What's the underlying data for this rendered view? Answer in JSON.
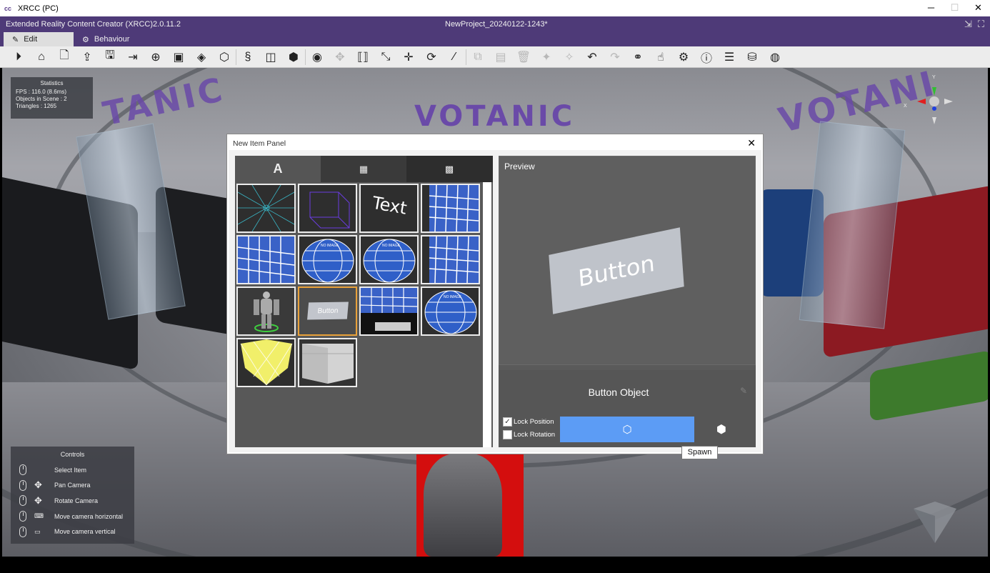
{
  "window": {
    "title": "XRCC (PC)",
    "minimize": "─",
    "maximize": "☐",
    "close": "✕"
  },
  "header": {
    "app_name": "Extended Reality Content Creator (XRCC)2.0.11.2",
    "project_name": "NewProject_20240122-1243*"
  },
  "tabs": [
    {
      "label": "Edit",
      "icon": "edit-icon",
      "active": true
    },
    {
      "label": "Behaviour",
      "icon": "gear-icon",
      "active": false
    }
  ],
  "toolbar": {
    "icons": [
      "play-icon",
      "home-icon",
      "new-file-icon",
      "import-icon",
      "save-icon",
      "save-as-icon",
      "export-icon",
      "cube-package-icon",
      "cube-import-icon",
      "cube-export-icon",
      "script-icon",
      "asset-icon",
      "cube-open-icon",
      "cube-add-icon",
      "eye-icon",
      "move-icon",
      "frame-icon",
      "scale-icon",
      "transform-icon",
      "rotate-cube-icon",
      "wand-icon",
      "copy-icon",
      "paste-icon",
      "trash-icon",
      "pin-icon",
      "multi-pin-icon",
      "undo-icon",
      "redo-icon",
      "link-icon",
      "touch-icon",
      "settings-icon",
      "info-icon",
      "stack-icon",
      "network-icon",
      "unity-icon"
    ]
  },
  "scene": {
    "brand_center": "VOTANIC",
    "brand_left": "TANIC",
    "brand_right": "VOTANI"
  },
  "statistics": {
    "title": "Statistics",
    "fps": "FPS : 116.0 (8.6ms)",
    "objects": "Objects in Scene : 2",
    "triangles": "Triangles : 1265"
  },
  "controls": {
    "title": "Controls",
    "rows": [
      {
        "label": "Select Item"
      },
      {
        "label": "Pan Camera"
      },
      {
        "label": "Rotate Camera"
      },
      {
        "label": "Move camera horizontal"
      },
      {
        "label": "Move camera vertical"
      }
    ]
  },
  "gizmo": {
    "x": "X",
    "y": "Y"
  },
  "modal": {
    "title": "New Item Panel",
    "close": "✕",
    "category_tabs": [
      "text-category-icon",
      "media-category-icon",
      "default-category-icon"
    ],
    "thumbnails": [
      {
        "name": "grid-floor"
      },
      {
        "name": "wire-cube"
      },
      {
        "name": "text",
        "label": "Text"
      },
      {
        "name": "grid-panel"
      },
      {
        "name": "grid-panel-2"
      },
      {
        "name": "sphere-no-image",
        "label": "NO IMAGE"
      },
      {
        "name": "sphere-no-image-2",
        "label": "NO IMAGE"
      },
      {
        "name": "grid-panel-3"
      },
      {
        "name": "avatar"
      },
      {
        "name": "button",
        "label": "Button",
        "selected": true
      },
      {
        "name": "grid-stand"
      },
      {
        "name": "sphere-no-image-3",
        "label": "NO IMAGE"
      },
      {
        "name": "yellow-cube"
      },
      {
        "name": "panel-board"
      }
    ],
    "preview_label": "Preview",
    "preview_text": "Button",
    "object_name": "Button Object",
    "lock_position": {
      "label": "Lock Position",
      "checked": true
    },
    "lock_rotation": {
      "label": "Lock Rotation",
      "checked": false
    },
    "spawn_tooltip": "Spawn"
  },
  "colors": {
    "header_purple": "#4e3a78",
    "selected_border": "#e9a23a",
    "spawn_blue": "#5c9cf5"
  }
}
